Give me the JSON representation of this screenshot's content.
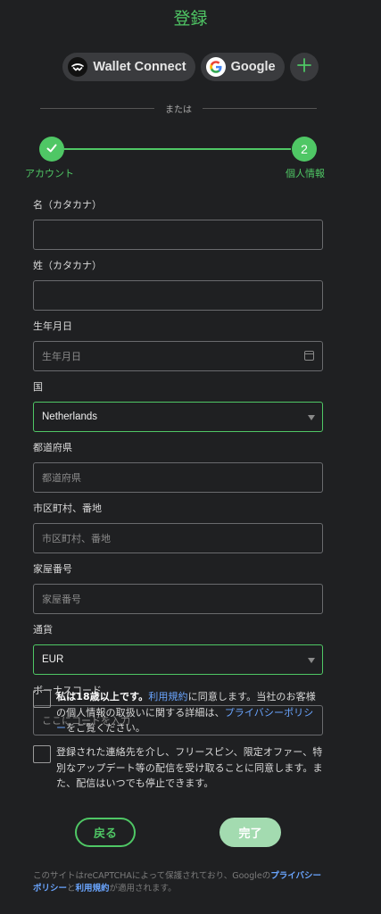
{
  "header": {
    "title": "登録"
  },
  "social": {
    "wallet_connect": "Wallet Connect",
    "google": "Google",
    "more_icon": "plus-icon"
  },
  "divider": {
    "text": "または"
  },
  "stepper": {
    "step1": {
      "label": "アカウント",
      "state": "completed",
      "icon": "check-icon"
    },
    "step2": {
      "label": "個人情報",
      "number": "2",
      "state": "active"
    }
  },
  "form": {
    "first_name": {
      "label": "名（カタカナ）",
      "value": "",
      "placeholder": ""
    },
    "last_name": {
      "label": "姓（カタカナ）",
      "value": "",
      "placeholder": ""
    },
    "birthdate": {
      "label": "生年月日",
      "placeholder": "生年月日",
      "icon": "calendar-icon"
    },
    "country": {
      "label": "国",
      "value": "Netherlands"
    },
    "prefecture": {
      "label": "都道府県",
      "placeholder": "都道府県"
    },
    "city": {
      "label": "市区町村、番地",
      "placeholder": "市区町村、番地"
    },
    "house_number": {
      "label": "家屋番号",
      "placeholder": "家屋番号"
    },
    "currency": {
      "label": "通貨",
      "value": "EUR"
    },
    "bonus_code": {
      "label": "ボーナスコード",
      "placeholder": "ここにコードを入力"
    }
  },
  "consent": {
    "terms": {
      "bold": "私は18歳以上です。",
      "link1": "利用規約",
      "text1": "に同意します。当社のお客様の個人情報の取扱いに関する詳細は、",
      "link2": "プライバシーポリシー",
      "text2": "をご覧ください。"
    },
    "marketing": {
      "text": "登録された連絡先を介し、フリースピン、限定オファー、特別なアップデート等の配信を受け取ることに同意します。また、配信はいつでも停止できます。"
    }
  },
  "actions": {
    "back": "戻る",
    "done": "完了"
  },
  "footer": {
    "text1": "このサイトはreCAPTCHAによって保護されており、Googleの",
    "link1": "プライバシーポリシー",
    "text2": "と",
    "link2": "利用規約",
    "text3": "が適用されます。"
  },
  "colors": {
    "accent": "#4fc765",
    "background": "#1f2022",
    "link": "#6aa5ff"
  }
}
